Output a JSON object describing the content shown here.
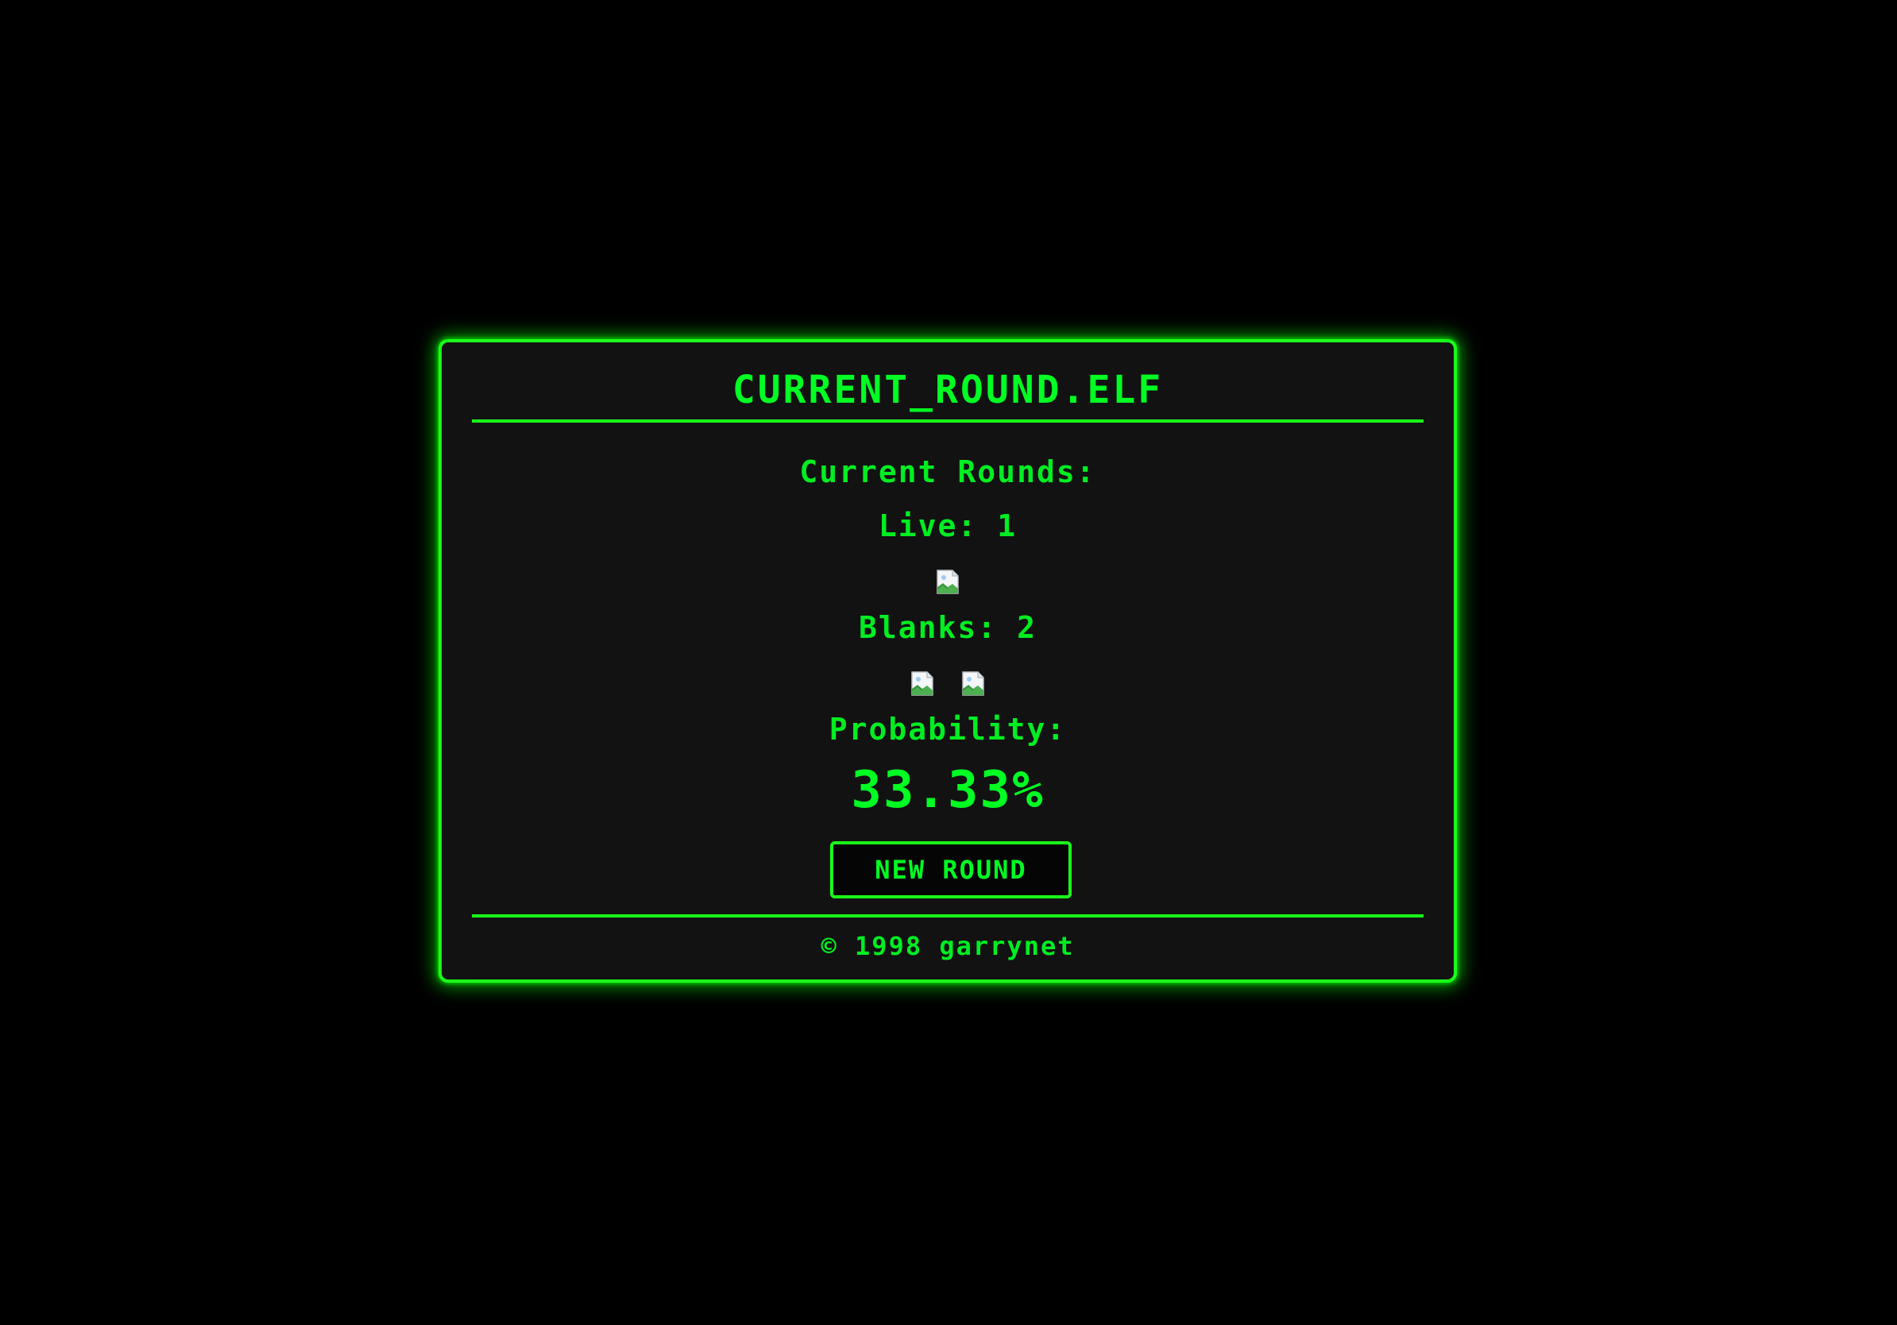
{
  "window": {
    "title": "CURRENT_ROUND.ELF"
  },
  "rounds": {
    "heading": "Current Rounds:",
    "live_label": "Live: 1",
    "live_count": 1,
    "blanks_label": "Blanks: 2",
    "blanks_count": 2,
    "shell_icon": "broken-image-icon"
  },
  "probability": {
    "label": "Probability:",
    "value": "33.33%"
  },
  "actions": {
    "new_round_label": "NEW ROUND"
  },
  "footer": {
    "text": "© 1998 garrynet"
  },
  "colors": {
    "accent": "#1aff1a",
    "text": "#00e600",
    "background": "#000000",
    "panel": "#121212"
  }
}
